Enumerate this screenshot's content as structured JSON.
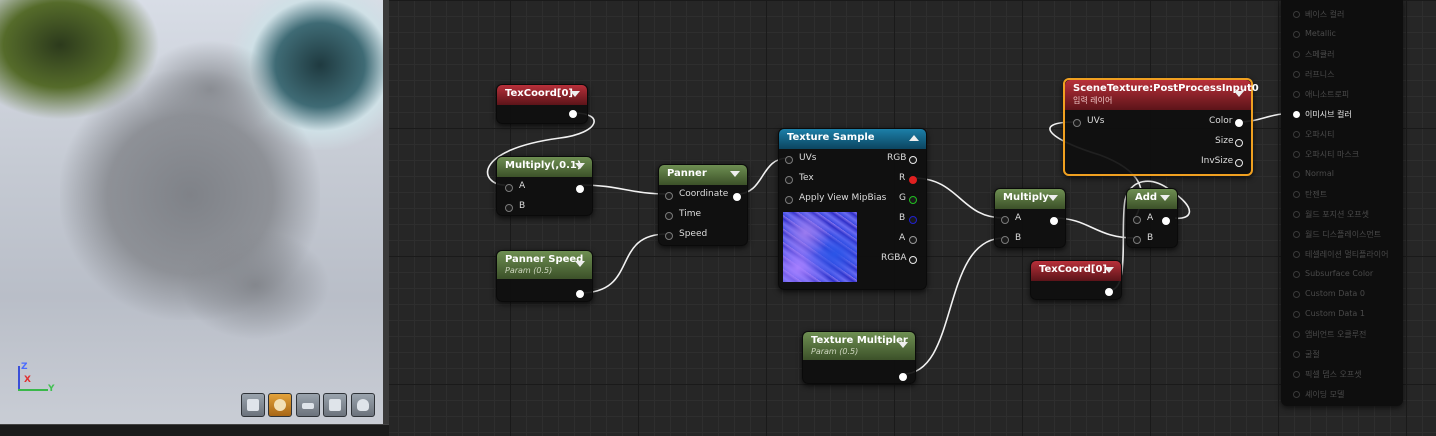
{
  "viewport": {
    "axis": {
      "z": "Z",
      "x": "X",
      "y": "Y"
    },
    "preview_shapes": [
      "cylinder-icon",
      "sphere-icon",
      "plane-icon",
      "cube-icon",
      "teapot-icon"
    ],
    "active_shape": "sphere-icon"
  },
  "nodes": {
    "texcoord1": {
      "title": "TexCoord[0]"
    },
    "multiply1": {
      "title": "Multiply(,0.1)",
      "pins": [
        "A",
        "B"
      ]
    },
    "panner_speed": {
      "title": "Panner Speed",
      "subtitle": "Param (0.5)"
    },
    "panner": {
      "title": "Panner",
      "pins": [
        "Coordinate",
        "Time",
        "Speed"
      ]
    },
    "texture_sample": {
      "title": "Texture Sample",
      "inputs": [
        "UVs",
        "Tex",
        "Apply View MipBias"
      ],
      "outputs": [
        "RGB",
        "R",
        "G",
        "B",
        "A",
        "RGBA"
      ]
    },
    "texture_multiplier": {
      "title": "Texture Multipler",
      "subtitle": "Param (0.5)"
    },
    "multiply2": {
      "title": "Multiply",
      "pins": [
        "A",
        "B"
      ]
    },
    "texcoord2": {
      "title": "TexCoord[0]"
    },
    "scene_texture": {
      "title": "SceneTexture:PostProcessInput0",
      "subtitle": "입력 레이어",
      "input": "UVs",
      "outputs": [
        "Color",
        "Size",
        "InvSize"
      ]
    },
    "add": {
      "title": "Add",
      "pins": [
        "A",
        "B"
      ]
    }
  },
  "result": {
    "items": [
      "베이스 컬러",
      "Metallic",
      "스페큘러",
      "러프니스",
      "애니소트로피",
      "이미시브 컬러",
      "오파시티",
      "오파시티 마스크",
      "Normal",
      "탄젠트",
      "월드 포지션 오프셋",
      "월드 디스플레이스먼트",
      "테셀레이션 멀티플라이어",
      "Subsurface Color",
      "Custom Data 0",
      "Custom Data 1",
      "앰비언트 오클루전",
      "굴절",
      "픽셀 뎁스 오프셋",
      "셰이딩 모델"
    ],
    "active_index": 5
  },
  "colors": {
    "header_red": "#b8303a",
    "header_green": "#6e8f52",
    "header_blue": "#1c7fa8",
    "selection": "#f0a020",
    "wire": "#ffffff",
    "pin_r": "#e02020",
    "pin_g": "#20c020",
    "pin_b": "#2020d0"
  }
}
